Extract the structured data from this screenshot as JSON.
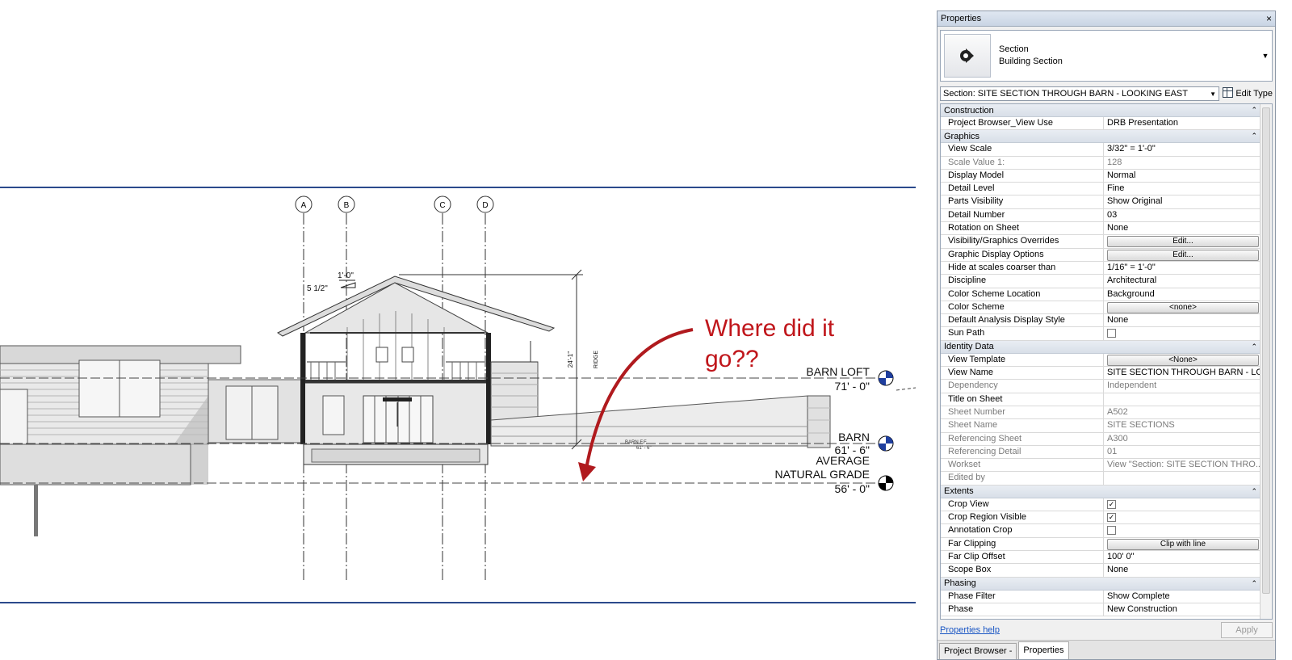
{
  "canvas": {
    "grid_labels": [
      "A",
      "B",
      "C",
      "D"
    ],
    "annotation": {
      "line1": "Where did it",
      "line2": "go??"
    },
    "dims": {
      "top": "1'-0\"",
      "slope": "5 1/2\"",
      "height": "24'-1\"",
      "ridge": "RIDGE"
    },
    "levels": {
      "barn_loft": {
        "name": "BARN LOFT",
        "elev": "71' - 0\""
      },
      "barn": {
        "name": "BARN",
        "elev": "61' - 6\""
      },
      "grade": {
        "name1": "AVERAGE",
        "name2": "NATURAL GRADE",
        "elev": "56' - 0\""
      },
      "barn_ff": {
        "name": "BARN F.F.",
        "elev": "61' - 6\""
      }
    },
    "colors": {
      "annotation": "#c0161b",
      "border": "#2b4a8c"
    }
  },
  "properties": {
    "title": "Properties",
    "close": "×",
    "type": {
      "family": "Section",
      "name": "Building Section",
      "icon": "section-head-icon"
    },
    "selector": "Section: SITE SECTION THROUGH BARN - LOOKING EAST",
    "edit_type": "Edit Type",
    "groups": [
      {
        "name": "Construction",
        "rows": [
          {
            "name": "Project Browser_View Use",
            "value": "DRB Presentation",
            "kind": "text"
          }
        ]
      },
      {
        "name": "Graphics",
        "rows": [
          {
            "name": "View Scale",
            "value": "3/32\" = 1'-0\"",
            "kind": "text"
          },
          {
            "name": "Scale Value    1:",
            "value": "128",
            "kind": "text",
            "dim": true
          },
          {
            "name": "Display Model",
            "value": "Normal",
            "kind": "text"
          },
          {
            "name": "Detail Level",
            "value": "Fine",
            "kind": "text"
          },
          {
            "name": "Parts Visibility",
            "value": "Show Original",
            "kind": "text"
          },
          {
            "name": "Detail Number",
            "value": "03",
            "kind": "text"
          },
          {
            "name": "Rotation on Sheet",
            "value": "None",
            "kind": "text"
          },
          {
            "name": "Visibility/Graphics Overrides",
            "value": "Edit...",
            "kind": "button"
          },
          {
            "name": "Graphic Display Options",
            "value": "Edit...",
            "kind": "button"
          },
          {
            "name": "Hide at scales coarser than",
            "value": "1/16\" = 1'-0\"",
            "kind": "text"
          },
          {
            "name": "Discipline",
            "value": "Architectural",
            "kind": "text"
          },
          {
            "name": "Color Scheme Location",
            "value": "Background",
            "kind": "text"
          },
          {
            "name": "Color Scheme",
            "value": "<none>",
            "kind": "button"
          },
          {
            "name": "Default Analysis Display Style",
            "value": "None",
            "kind": "text"
          },
          {
            "name": "Sun Path",
            "value": "",
            "kind": "checkbox",
            "checked": false
          }
        ]
      },
      {
        "name": "Identity Data",
        "rows": [
          {
            "name": "View Template",
            "value": "<None>",
            "kind": "button"
          },
          {
            "name": "View Name",
            "value": "SITE SECTION THROUGH BARN - LO...",
            "kind": "text"
          },
          {
            "name": "Dependency",
            "value": "Independent",
            "kind": "text",
            "dim": true
          },
          {
            "name": "Title on Sheet",
            "value": "",
            "kind": "text"
          },
          {
            "name": "Sheet Number",
            "value": "A502",
            "kind": "text",
            "dim": true
          },
          {
            "name": "Sheet Name",
            "value": "SITE SECTIONS",
            "kind": "text",
            "dim": true
          },
          {
            "name": "Referencing Sheet",
            "value": "A300",
            "kind": "text",
            "dim": true
          },
          {
            "name": "Referencing Detail",
            "value": "01",
            "kind": "text",
            "dim": true
          },
          {
            "name": "Workset",
            "value": "View \"Section: SITE SECTION THRO...",
            "kind": "text",
            "dim": true
          },
          {
            "name": "Edited by",
            "value": "",
            "kind": "text",
            "dim": true
          }
        ]
      },
      {
        "name": "Extents",
        "rows": [
          {
            "name": "Crop View",
            "value": "",
            "kind": "checkbox",
            "checked": true
          },
          {
            "name": "Crop Region Visible",
            "value": "",
            "kind": "checkbox",
            "checked": true
          },
          {
            "name": "Annotation Crop",
            "value": "",
            "kind": "checkbox",
            "checked": false
          },
          {
            "name": "Far Clipping",
            "value": "Clip with line",
            "kind": "button"
          },
          {
            "name": "Far Clip Offset",
            "value": "100'  0\"",
            "kind": "text"
          },
          {
            "name": "Scope Box",
            "value": "None",
            "kind": "text"
          }
        ]
      },
      {
        "name": "Phasing",
        "rows": [
          {
            "name": "Phase Filter",
            "value": "Show Complete",
            "kind": "text"
          },
          {
            "name": "Phase",
            "value": "New Construction",
            "kind": "text"
          }
        ]
      }
    ],
    "help_link": "Properties help",
    "apply": "Apply",
    "tabs": [
      {
        "label": "Project Browser -",
        "active": false
      },
      {
        "label": "Properties",
        "active": true
      }
    ]
  }
}
